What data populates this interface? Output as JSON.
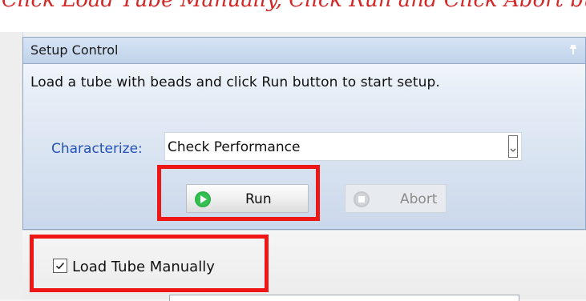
{
  "page": {
    "top_caption": "Click Load Tube Manually, Click Run and Click Abort button"
  },
  "setup_control": {
    "title": "Setup Control",
    "instruction": "Load a tube with beads and click Run button to start setup.",
    "characterize_label": "Characterize:",
    "selected_characterization": "Check Performance",
    "run_label": "Run",
    "abort_label": "Abort"
  },
  "load_options": {
    "checkbox_label": "Load Tube Manually",
    "checked": true
  },
  "icons": {
    "pin": "pin-icon",
    "dropdown": "chevron-down-icon",
    "run": "play-icon",
    "abort": "stop-icon",
    "checkbox": "checkmark-icon"
  },
  "colors": {
    "highlight": "#ef1616",
    "link_label": "#2251b8",
    "panel_header": "#c7d7ec"
  }
}
